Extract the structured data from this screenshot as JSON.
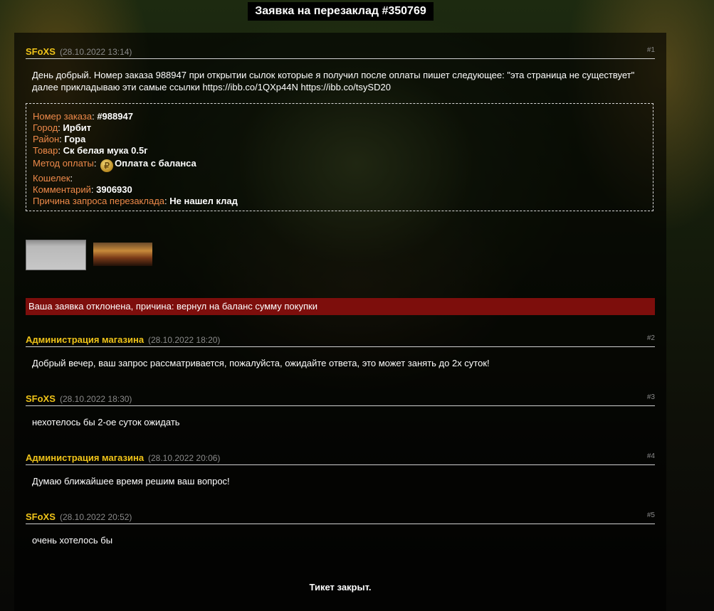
{
  "page": {
    "title": "Заявка на перезаклад #350769"
  },
  "messages": [
    {
      "author": "SFoXS",
      "date": "(28.10.2022 13:14)",
      "num": "#1",
      "text": "День добрый. Номер заказа 988947 при открытии сылок которые я получил после оплаты пишет следующее: \"эта страница не существует\" далее прикладываю эти самые ссылки https://ibb.co/1QXp44N https://ibb.co/tsySD20"
    },
    {
      "author": "Администрация магазина",
      "date": "(28.10.2022 18:20)",
      "num": "#2",
      "text": "Добрый вечер, ваш запрос рассматривается, пожалуйста, ожидайте ответа, это может занять до 2х суток!"
    },
    {
      "author": "SFoXS",
      "date": "(28.10.2022 18:30)",
      "num": "#3",
      "text": "нехотелось бы 2-ое суток ожидать"
    },
    {
      "author": "Администрация магазина",
      "date": "(28.10.2022 20:06)",
      "num": "#4",
      "text": "Думаю ближайшее время решим ваш вопрос!"
    },
    {
      "author": "SFoXS",
      "date": "(28.10.2022 20:52)",
      "num": "#5",
      "text": "очень хотелось бы"
    }
  ],
  "order": {
    "order_number_label": "Номер заказа",
    "order_number": "#988947",
    "city_label": "Город",
    "city": "Ирбит",
    "district_label": "Район",
    "district": "Гора",
    "product_label": "Товар",
    "product": "Ск белая мука 0.5г",
    "payment_label": "Метод оплаты",
    "payment_icon": "ruble-coin-icon",
    "payment": "Оплата с баланса",
    "wallet_label": "Кошелек",
    "comment_label": "Комментарий",
    "comment": "3906930",
    "reason_label": "Причина запроса перезаклада",
    "reason": "Не нашел клад"
  },
  "rejection": "Ваша заявка отклонена, причина: вернул на баланс сумму покупки",
  "footer": {
    "status": "Тикет закрыт."
  },
  "colors": {
    "author": "#f0c419",
    "label": "#ef8a4a",
    "reject_bg": "#7d0e0c"
  }
}
